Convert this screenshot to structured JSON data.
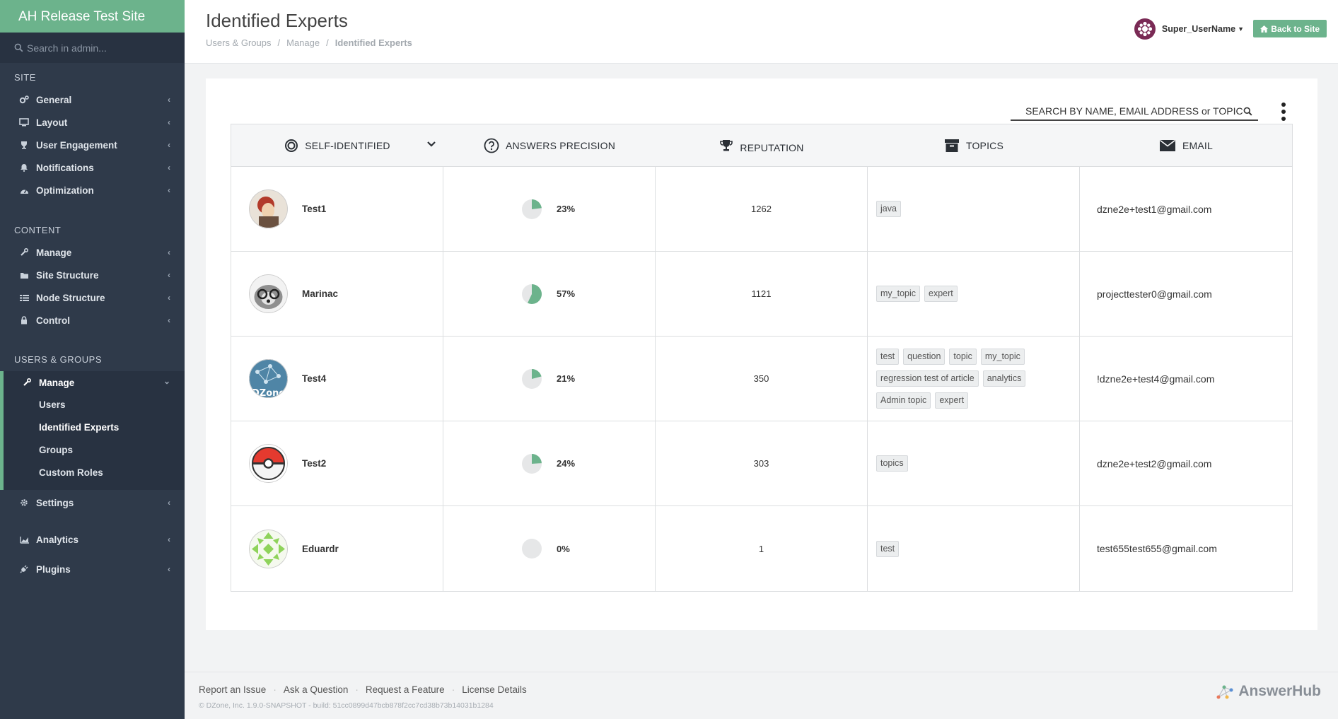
{
  "sidebar": {
    "brand": "AH Release Test Site",
    "search_placeholder": "Search in admin...",
    "sections": {
      "site": "SITE",
      "content": "CONTENT",
      "users_groups": "USERS & GROUPS"
    },
    "site_items": [
      {
        "label": "General",
        "icon": "cogs-icon"
      },
      {
        "label": "Layout",
        "icon": "monitor-icon"
      },
      {
        "label": "User Engagement",
        "icon": "trophy-icon"
      },
      {
        "label": "Notifications",
        "icon": "bell-icon"
      },
      {
        "label": "Optimization",
        "icon": "dashboard-icon"
      }
    ],
    "content_items": [
      {
        "label": "Manage",
        "icon": "wrench-icon"
      },
      {
        "label": "Site Structure",
        "icon": "folder-icon"
      },
      {
        "label": "Node Structure",
        "icon": "list-icon"
      },
      {
        "label": "Control",
        "icon": "lock-icon"
      }
    ],
    "users_manage": "Manage",
    "users_sub": [
      "Users",
      "Identified Experts",
      "Groups",
      "Custom Roles"
    ],
    "bottom_items": [
      {
        "label": "Settings",
        "icon": "gear-icon"
      },
      {
        "label": "Analytics",
        "icon": "area-chart-icon"
      },
      {
        "label": "Plugins",
        "icon": "plug-icon"
      }
    ]
  },
  "header": {
    "title": "Identified Experts",
    "breadcrumb": [
      "Users & Groups",
      "Manage",
      "Identified Experts"
    ],
    "breadcrumb_sep": "/",
    "username": "Super_UserName",
    "back_button": "Back to Site"
  },
  "table": {
    "search_placeholder": "SEARCH BY NAME, EMAIL ADDRESS or TOPIC",
    "columns": [
      "SELF-IDENTIFIED",
      "ANSWERS PRECISION",
      "REPUTATION",
      "TOPICS",
      "EMAIL"
    ],
    "rows": [
      {
        "name": "Test1",
        "precision": 23,
        "precision_label": "23%",
        "reputation": "1262",
        "topics": [
          "java"
        ],
        "email": "dzne2e+test1@gmail.com"
      },
      {
        "name": "Marinac",
        "precision": 57,
        "precision_label": "57%",
        "reputation": "1121",
        "topics": [
          "my_topic",
          "expert"
        ],
        "email": "projecttester0@gmail.com"
      },
      {
        "name": "Test4",
        "precision": 21,
        "precision_label": "21%",
        "reputation": "350",
        "topics": [
          "test",
          "question",
          "topic",
          "my_topic",
          "regression test of article",
          "analytics",
          "Admin topic",
          "expert"
        ],
        "email": "!dzne2e+test4@gmail.com"
      },
      {
        "name": "Test2",
        "precision": 24,
        "precision_label": "24%",
        "reputation": "303",
        "topics": [
          "topics"
        ],
        "email": "dzne2e+test2@gmail.com"
      },
      {
        "name": "Eduardr",
        "precision": 0,
        "precision_label": "0%",
        "reputation": "1",
        "topics": [
          "test"
        ],
        "email": "test655test655@gmail.com"
      }
    ]
  },
  "footer": {
    "links": [
      "Report an Issue",
      "Ask a Question",
      "Request a Feature",
      "License Details"
    ],
    "separator": "·",
    "copyright": "© DZone, Inc. 1.9.0-SNAPSHOT - build: 51cc0899d47bcb878f2cc7cd38b73b14031b1284",
    "logo_text": "AnswerHub"
  },
  "colors": {
    "accent": "#6cb38c",
    "sidebar_bg": "#2f3a4a",
    "pie_bg": "#e6e7e8"
  }
}
